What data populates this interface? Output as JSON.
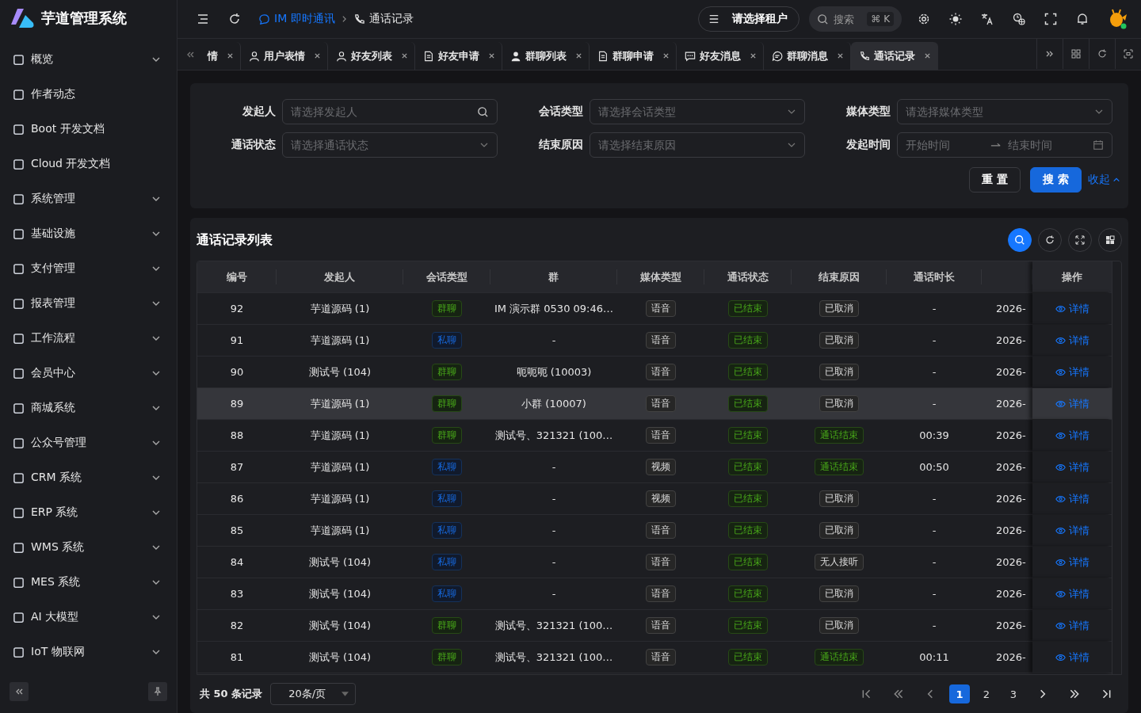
{
  "app": {
    "title": "芋道管理系统"
  },
  "sidebar": {
    "items": [
      {
        "label": "概览",
        "expandable": true
      },
      {
        "label": "作者动态",
        "expandable": false
      },
      {
        "label": "Boot 开发文档",
        "expandable": false
      },
      {
        "label": "Cloud 开发文档",
        "expandable": false
      },
      {
        "label": "系统管理",
        "expandable": true
      },
      {
        "label": "基础设施",
        "expandable": true
      },
      {
        "label": "支付管理",
        "expandable": true
      },
      {
        "label": "报表管理",
        "expandable": true
      },
      {
        "label": "工作流程",
        "expandable": true
      },
      {
        "label": "会员中心",
        "expandable": true
      },
      {
        "label": "商城系统",
        "expandable": true
      },
      {
        "label": "公众号管理",
        "expandable": true
      },
      {
        "label": "CRM 系统",
        "expandable": true
      },
      {
        "label": "ERP 系统",
        "expandable": true
      },
      {
        "label": "WMS 系统",
        "expandable": true
      },
      {
        "label": "MES 系统",
        "expandable": true
      },
      {
        "label": "AI 大模型",
        "expandable": true
      },
      {
        "label": "IoT 物联网",
        "expandable": true
      }
    ]
  },
  "breadcrumb": [
    {
      "label": "IM 即时通讯",
      "kind": "chat"
    },
    {
      "label": "通话记录",
      "kind": "phone"
    }
  ],
  "tenant": {
    "label": "请选择租户"
  },
  "search": {
    "placeholder": "搜索",
    "shortcut": "⌘ K"
  },
  "tabs": [
    {
      "label": "情",
      "kind": "none",
      "selected": false
    },
    {
      "label": "用户表情",
      "kind": "user",
      "selected": false
    },
    {
      "label": "好友列表",
      "kind": "user",
      "selected": false
    },
    {
      "label": "好友申请",
      "kind": "doc",
      "selected": false
    },
    {
      "label": "群聊列表",
      "kind": "person",
      "selected": false
    },
    {
      "label": "群聊申请",
      "kind": "doc",
      "selected": false
    },
    {
      "label": "好友消息",
      "kind": "msg",
      "selected": false
    },
    {
      "label": "群聊消息",
      "kind": "chat",
      "selected": false
    },
    {
      "label": "通话记录",
      "kind": "phone",
      "selected": true
    }
  ],
  "filters": [
    {
      "label": "发起人",
      "placeholder": "请选择发起人",
      "kind": "search"
    },
    {
      "label": "会话类型",
      "placeholder": "请选择会话类型",
      "kind": "select"
    },
    {
      "label": "媒体类型",
      "placeholder": "请选择媒体类型",
      "kind": "select"
    },
    {
      "label": "通话状态",
      "placeholder": "请选择通话状态",
      "kind": "select"
    },
    {
      "label": "结束原因",
      "placeholder": "请选择结束原因",
      "kind": "select"
    },
    {
      "label": "发起时间",
      "placeholder": "开始时间",
      "placeholder_end": "结束时间",
      "kind": "range"
    }
  ],
  "filter_buttons": {
    "reset": "重 置",
    "search": "搜 索",
    "collapse": "收起"
  },
  "table": {
    "title": "通话记录列表",
    "columns": [
      "编号",
      "发起人",
      "会话类型",
      "群",
      "媒体类型",
      "通话状态",
      "结束原因",
      "通话时长"
    ],
    "action_column": "操作",
    "rows": [
      {
        "id": "92",
        "caller": "芋道源码 (1)",
        "session": {
          "label": "群聊",
          "kind": "success"
        },
        "group": "IM 演示群 0530 09:46…",
        "media": "语音",
        "status": {
          "label": "已结束",
          "kind": "success"
        },
        "reason": {
          "label": "已取消",
          "kind": "default"
        },
        "duration": "-",
        "column_9": "2026-",
        "action": "详情",
        "selected": false
      },
      {
        "id": "91",
        "caller": "芋道源码 (1)",
        "session": {
          "label": "私聊",
          "kind": "primary"
        },
        "group": "-",
        "media": "语音",
        "status": {
          "label": "已结束",
          "kind": "success"
        },
        "reason": {
          "label": "已取消",
          "kind": "default"
        },
        "duration": "-",
        "column_9": "2026-",
        "action": "详情",
        "selected": false
      },
      {
        "id": "90",
        "caller": "测试号 (104)",
        "session": {
          "label": "群聊",
          "kind": "success"
        },
        "group": "呃呃呃 (10003)",
        "media": "语音",
        "status": {
          "label": "已结束",
          "kind": "success"
        },
        "reason": {
          "label": "已取消",
          "kind": "default"
        },
        "duration": "-",
        "column_9": "2026-",
        "action": "详情",
        "selected": false
      },
      {
        "id": "89",
        "caller": "芋道源码 (1)",
        "session": {
          "label": "群聊",
          "kind": "success"
        },
        "group": "小群 (10007)",
        "media": "语音",
        "status": {
          "label": "已结束",
          "kind": "success"
        },
        "reason": {
          "label": "已取消",
          "kind": "default"
        },
        "duration": "-",
        "column_9": "2026-",
        "action": "详情",
        "selected": true
      },
      {
        "id": "88",
        "caller": "芋道源码 (1)",
        "session": {
          "label": "群聊",
          "kind": "success"
        },
        "group": "测试号、321321 (100…",
        "media": "语音",
        "status": {
          "label": "已结束",
          "kind": "success"
        },
        "reason": {
          "label": "通话结束",
          "kind": "success"
        },
        "duration": "00:39",
        "column_9": "2026-",
        "action": "详情",
        "selected": false
      },
      {
        "id": "87",
        "caller": "芋道源码 (1)",
        "session": {
          "label": "私聊",
          "kind": "primary"
        },
        "group": "-",
        "media": "视频",
        "status": {
          "label": "已结束",
          "kind": "success"
        },
        "reason": {
          "label": "通话结束",
          "kind": "success"
        },
        "duration": "00:50",
        "column_9": "2026-",
        "action": "详情",
        "selected": false
      },
      {
        "id": "86",
        "caller": "芋道源码 (1)",
        "session": {
          "label": "私聊",
          "kind": "primary"
        },
        "group": "-",
        "media": "视频",
        "status": {
          "label": "已结束",
          "kind": "success"
        },
        "reason": {
          "label": "已取消",
          "kind": "default"
        },
        "duration": "-",
        "column_9": "2026-",
        "action": "详情",
        "selected": false
      },
      {
        "id": "85",
        "caller": "芋道源码 (1)",
        "session": {
          "label": "私聊",
          "kind": "primary"
        },
        "group": "-",
        "media": "语音",
        "status": {
          "label": "已结束",
          "kind": "success"
        },
        "reason": {
          "label": "已取消",
          "kind": "default"
        },
        "duration": "-",
        "column_9": "2026-",
        "action": "详情",
        "selected": false
      },
      {
        "id": "84",
        "caller": "测试号 (104)",
        "session": {
          "label": "私聊",
          "kind": "primary"
        },
        "group": "-",
        "media": "语音",
        "status": {
          "label": "已结束",
          "kind": "success"
        },
        "reason": {
          "label": "无人接听",
          "kind": "default"
        },
        "duration": "-",
        "column_9": "2026-",
        "action": "详情",
        "selected": false
      },
      {
        "id": "83",
        "caller": "测试号 (104)",
        "session": {
          "label": "私聊",
          "kind": "primary"
        },
        "group": "-",
        "media": "语音",
        "status": {
          "label": "已结束",
          "kind": "success"
        },
        "reason": {
          "label": "已取消",
          "kind": "default"
        },
        "duration": "-",
        "column_9": "2026-",
        "action": "详情",
        "selected": false
      },
      {
        "id": "82",
        "caller": "测试号 (104)",
        "session": {
          "label": "群聊",
          "kind": "success"
        },
        "group": "测试号、321321 (100…",
        "media": "语音",
        "status": {
          "label": "已结束",
          "kind": "success"
        },
        "reason": {
          "label": "已取消",
          "kind": "default"
        },
        "duration": "-",
        "column_9": "2026-",
        "action": "详情",
        "selected": false
      },
      {
        "id": "81",
        "caller": "测试号 (104)",
        "session": {
          "label": "群聊",
          "kind": "success"
        },
        "group": "测试号、321321 (100…",
        "media": "语音",
        "status": {
          "label": "已结束",
          "kind": "success"
        },
        "reason": {
          "label": "通话结束",
          "kind": "success"
        },
        "duration": "00:11",
        "column_9": "2026-",
        "action": "详情",
        "selected": false
      }
    ]
  },
  "pagination": {
    "total": "共 50 条记录",
    "page_size": "20条/页",
    "pages": [
      {
        "label": "1",
        "selected": true
      },
      {
        "label": "2",
        "selected": false
      },
      {
        "label": "3",
        "selected": false
      }
    ]
  }
}
